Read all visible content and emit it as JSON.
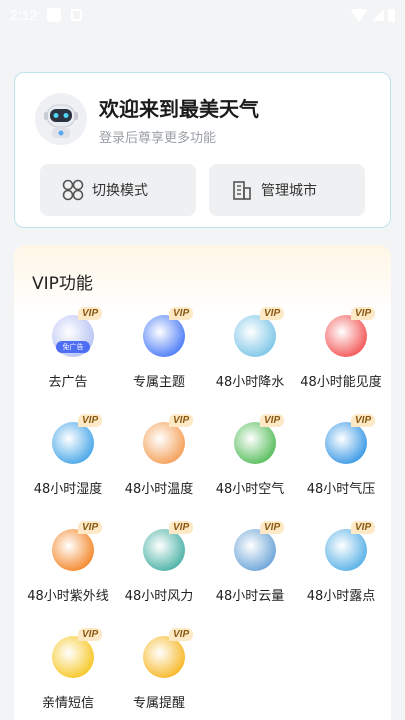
{
  "status_bar": {
    "time": "2:12"
  },
  "welcome": {
    "title": "欢迎来到最美天气",
    "subtitle": "登录后尊享更多功能",
    "switch_mode_label": "切换模式",
    "manage_city_label": "管理城市"
  },
  "vip": {
    "title": "VIP功能",
    "badge": "VIP",
    "ad_chip": "免广告",
    "items": [
      {
        "label": "去广告",
        "icon": "no-ads-icon",
        "color": "#b9c4f5"
      },
      {
        "label": "专属主题",
        "icon": "theme-icon",
        "color": "#4f7ef7"
      },
      {
        "label": "48小时降水",
        "icon": "rain-drops-icon",
        "color": "#7fc7e8"
      },
      {
        "label": "48小时能见度",
        "icon": "visibility-eye-icon",
        "color": "#f45a5a"
      },
      {
        "label": "48小时湿度",
        "icon": "humidity-drop-icon",
        "color": "#4aa8e8"
      },
      {
        "label": "48小时温度",
        "icon": "thermometer-icon",
        "color": "#f4a15a"
      },
      {
        "label": "48小时空气",
        "icon": "leaf-icon",
        "color": "#5abf5f"
      },
      {
        "label": "48小时气压",
        "icon": "pressure-icon",
        "color": "#3e9be6"
      },
      {
        "label": "48小时紫外线",
        "icon": "uv-umbrella-icon",
        "color": "#f48a2e"
      },
      {
        "label": "48小时风力",
        "icon": "wind-icon",
        "color": "#4fb3a8"
      },
      {
        "label": "48小时云量",
        "icon": "cloud-icon",
        "color": "#6fa6d8"
      },
      {
        "label": "48小时露点",
        "icon": "dew-icon",
        "color": "#5bb2e6"
      },
      {
        "label": "亲情短信",
        "icon": "message-icon",
        "color": "#f7c82a"
      },
      {
        "label": "专属提醒",
        "icon": "bell-icon",
        "color": "#f7b92a"
      }
    ]
  }
}
